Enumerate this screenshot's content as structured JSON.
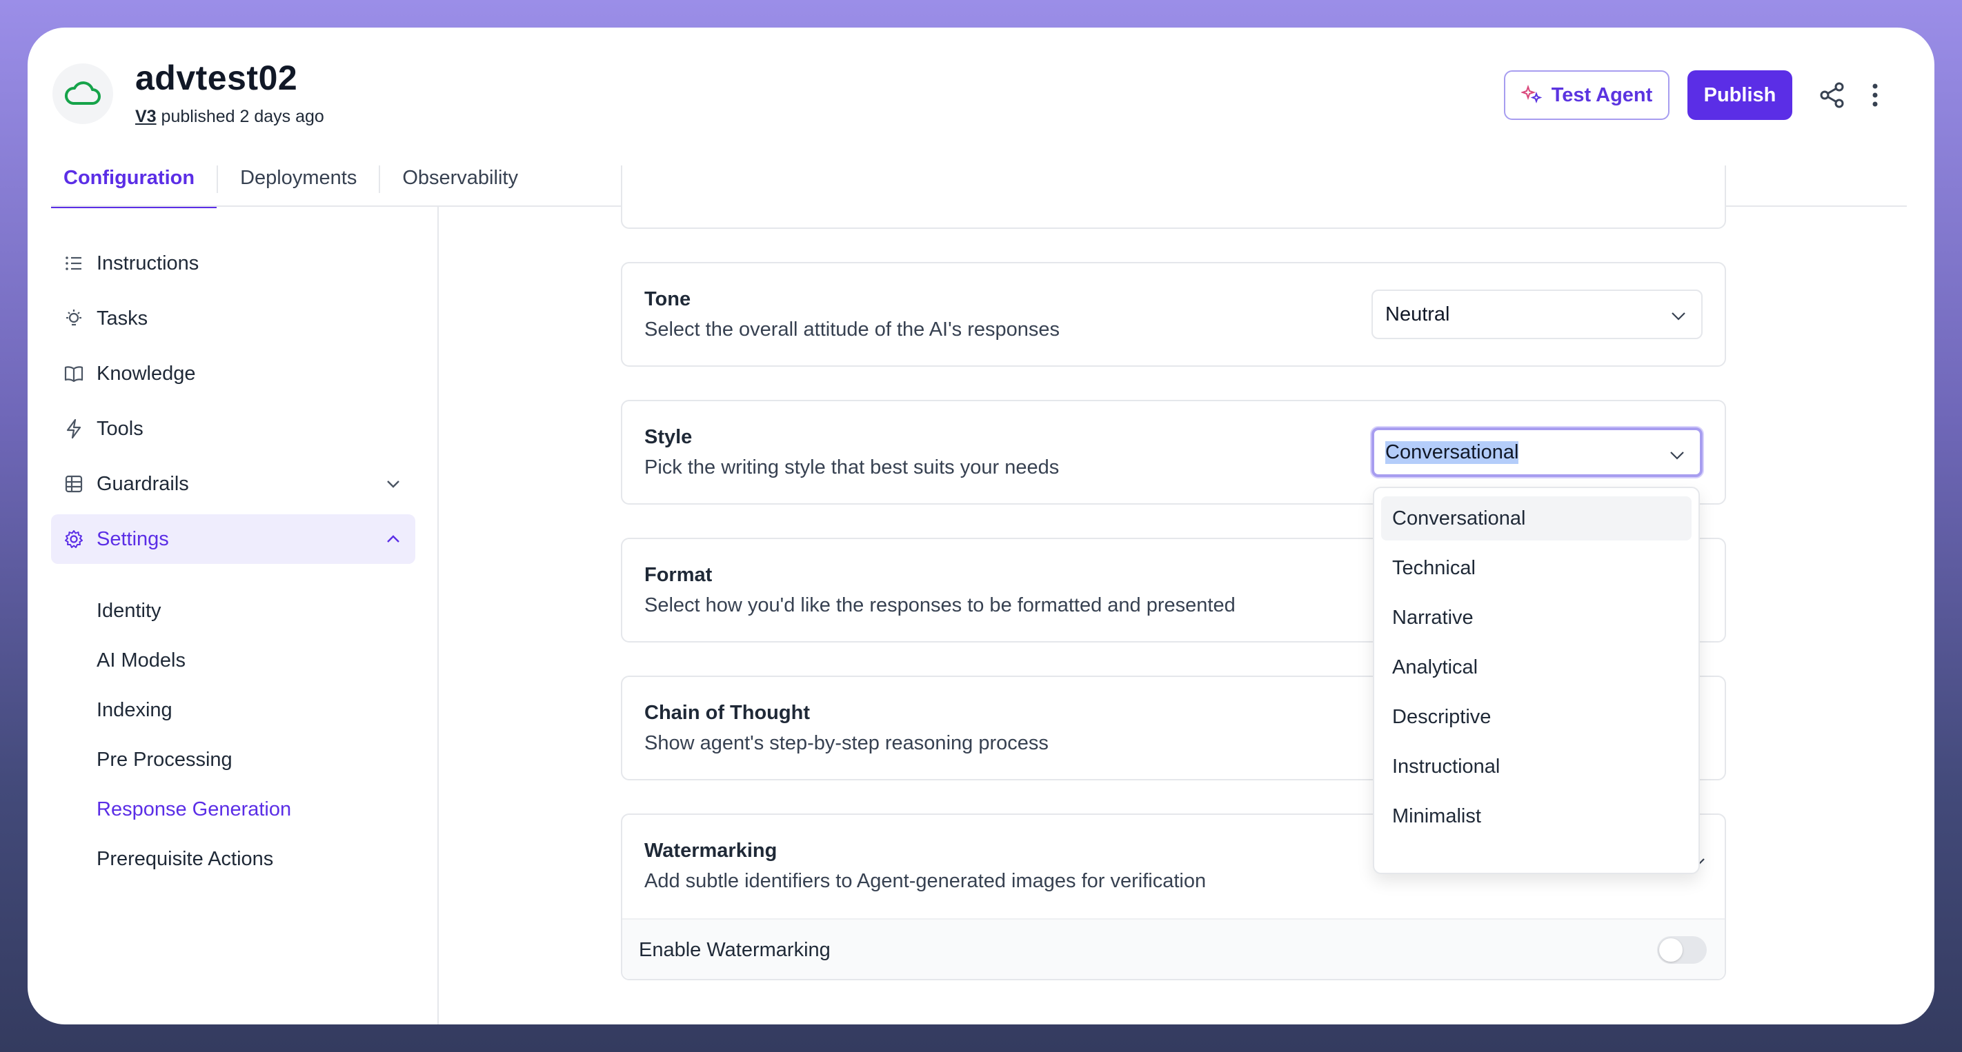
{
  "header": {
    "agent_name": "advtest02",
    "version": "V3",
    "published_text": "published 2 days ago",
    "test_agent_label": "Test Agent",
    "publish_label": "Publish"
  },
  "tabs": [
    {
      "label": "Configuration",
      "active": true
    },
    {
      "label": "Deployments",
      "active": false
    },
    {
      "label": "Observability",
      "active": false
    }
  ],
  "sidebar": {
    "items": [
      {
        "label": "Instructions",
        "icon": "list-icon"
      },
      {
        "label": "Tasks",
        "icon": "lightbulb-icon"
      },
      {
        "label": "Knowledge",
        "icon": "book-icon"
      },
      {
        "label": "Tools",
        "icon": "bolt-icon"
      },
      {
        "label": "Guardrails",
        "icon": "grid-icon"
      },
      {
        "label": "Settings",
        "icon": "gear-icon",
        "active": true
      }
    ],
    "settings_subitems": [
      {
        "label": "Identity"
      },
      {
        "label": "AI Models"
      },
      {
        "label": "Indexing"
      },
      {
        "label": "Pre Processing"
      },
      {
        "label": "Response Generation",
        "active": true
      },
      {
        "label": "Prerequisite Actions"
      }
    ]
  },
  "settings": {
    "tone": {
      "title": "Tone",
      "description": "Select the overall attitude of the AI's responses",
      "value": "Neutral"
    },
    "style": {
      "title": "Style",
      "description": "Pick the writing style that best suits your needs",
      "value": "Conversational"
    },
    "format": {
      "title": "Format",
      "description": "Select how you'd like the responses to be formatted and presented"
    },
    "chain_of_thought": {
      "title": "Chain of Thought",
      "description": "Show agent's step-by-step reasoning process"
    },
    "watermarking": {
      "title": "Watermarking",
      "description": "Add subtle identifiers to Agent-generated images for verification",
      "enable_label": "Enable Watermarking",
      "enabled": false
    }
  },
  "style_options": [
    "Conversational",
    "Technical",
    "Narrative",
    "Analytical",
    "Descriptive",
    "Instructional",
    "Minimalist"
  ],
  "colors": {
    "accent": "#5b2ee6",
    "accent_light": "#efedfd",
    "border": "#e5e7eb"
  }
}
